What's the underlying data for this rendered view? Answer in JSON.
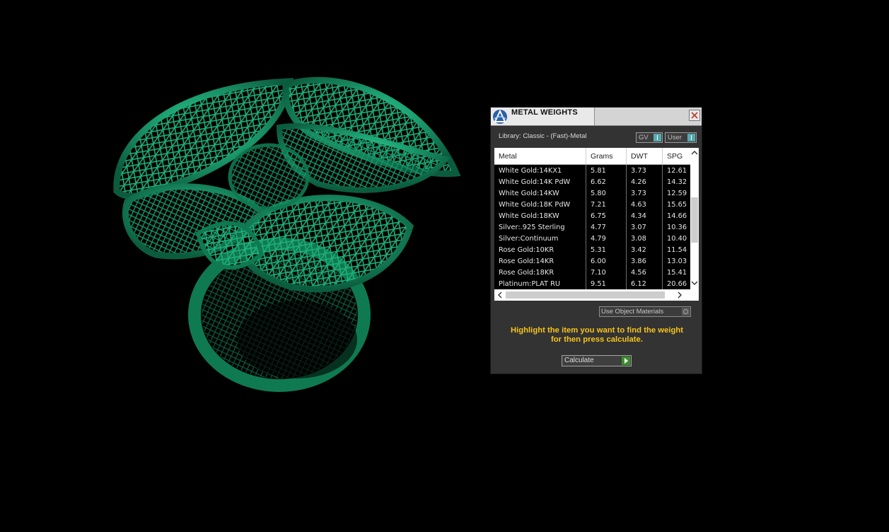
{
  "window": {
    "title": "METAL WEIGHTS",
    "library_label": "Library: Classic - (Fast)-Metal",
    "gv_toggle_label": "GV",
    "user_toggle_label": "User"
  },
  "table": {
    "columns": [
      "Metal",
      "Grams",
      "DWT",
      "SPG"
    ],
    "rows": [
      [
        "White Gold:14KX1",
        "5.81",
        "3.73",
        "12.61"
      ],
      [
        "White Gold:14K PdW",
        "6.62",
        "4.26",
        "14.32"
      ],
      [
        "White Gold:14KW",
        "5.80",
        "3.73",
        "12.59"
      ],
      [
        "White Gold:18K PdW",
        "7.21",
        "4.63",
        "15.65"
      ],
      [
        "White Gold:18KW",
        "6.75",
        "4.34",
        "14.66"
      ],
      [
        "Silver:.925 Sterling",
        "4.77",
        "3.07",
        "10.36"
      ],
      [
        "Silver:Continuum",
        "4.79",
        "3.08",
        "10.40"
      ],
      [
        "Rose Gold:10KR",
        "5.31",
        "3.42",
        "11.54"
      ],
      [
        "Rose Gold:14KR",
        "6.00",
        "3.86",
        "13.03"
      ],
      [
        "Rose Gold:18KR",
        "7.10",
        "4.56",
        "15.41"
      ],
      [
        "Platinum:PLAT RU",
        "9.51",
        "6.12",
        "20.66"
      ]
    ]
  },
  "options": {
    "use_object_materials_label": "Use Object Materials"
  },
  "hint": {
    "line1": "Highlight the item you want to find the weight",
    "line2": "for then press calculate."
  },
  "actions": {
    "calculate_label": "Calculate"
  },
  "colors": {
    "background": "#000000",
    "model_green": "#0f7a52",
    "panel_bg": "#333333",
    "hint_yellow": "#f5c31c"
  },
  "icons": {
    "app_logo": "app-logo-icon",
    "close": "close-icon",
    "calculate": "play-arrow-icon"
  }
}
